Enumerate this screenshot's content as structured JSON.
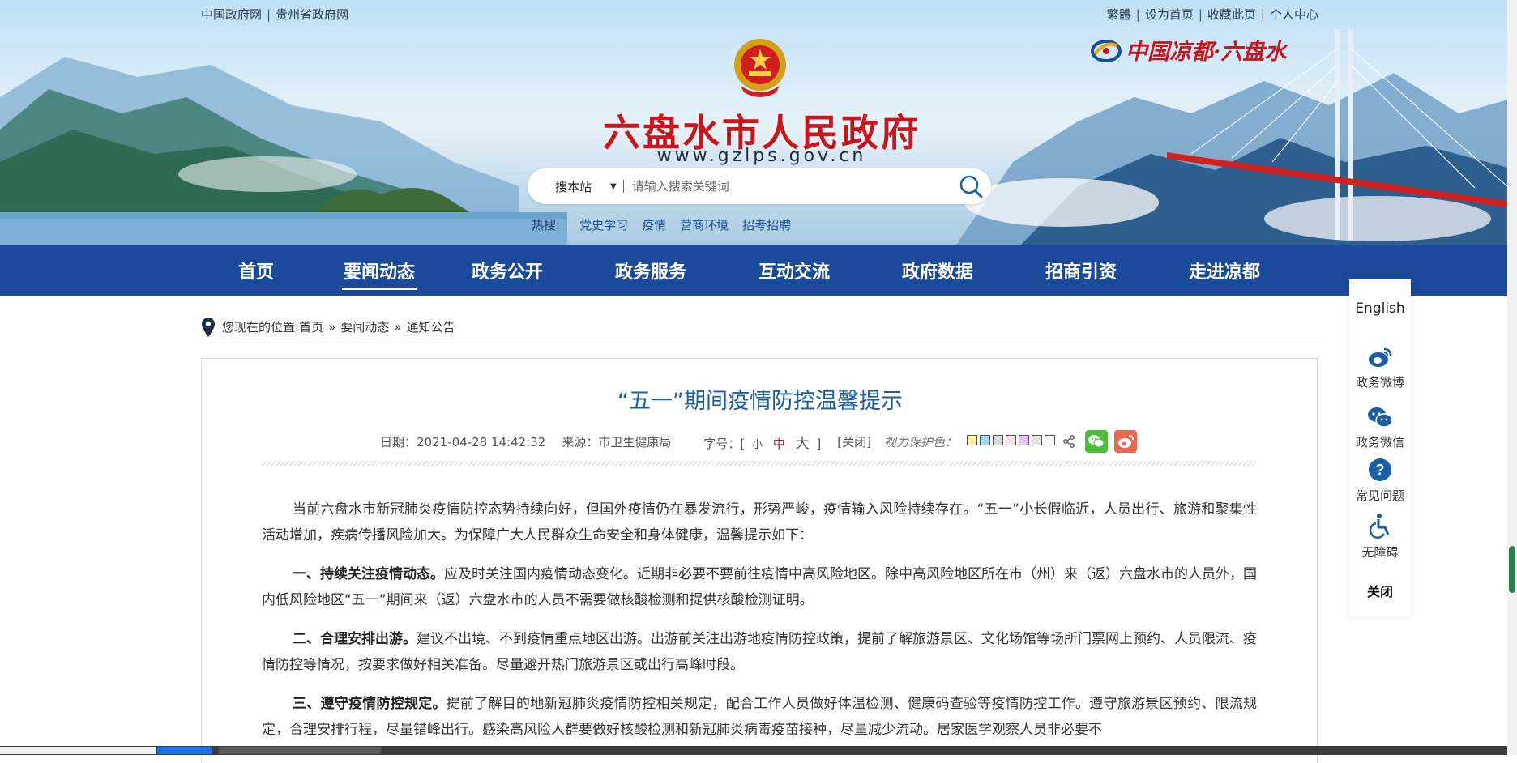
{
  "topbar": {
    "left_links": [
      "中国政府网",
      "贵州省政府网"
    ],
    "right_links": [
      "繁體",
      "设为首页",
      "收藏此页",
      "个人中心"
    ],
    "separator": "|"
  },
  "header": {
    "title": "六盘水市人民政府",
    "url": "www.gzlps.gov.cn",
    "brand_text": "中国凉都·六盘水",
    "emblem_icon": "national-emblem-icon"
  },
  "search": {
    "scope": "搜本站",
    "scope_caret": "▼",
    "placeholder": "请输入搜索关键词",
    "hot_label": "热搜:",
    "hot_words": [
      "党史学习",
      "疫情",
      "营商环境",
      "招考招聘"
    ]
  },
  "nav": {
    "items": [
      "首页",
      "要闻动态",
      "政务公开",
      "政务服务",
      "互动交流",
      "政府数据",
      "招商引资",
      "走进凉都"
    ],
    "active_index": 1
  },
  "breadcrumb": {
    "prefix": "您现在的位置:",
    "items": [
      "首页",
      "要闻动态",
      "通知公告"
    ],
    "separator": "»"
  },
  "article": {
    "title": "“五一”期间疫情防控温馨提示",
    "date": "日期：2021-04-28 14:42:32",
    "source": "来源：市卫生健康局",
    "font_label": "字号：",
    "font_open": "[",
    "font_small": "小",
    "font_medium": "中",
    "font_large": "大",
    "font_close": "]",
    "close_link": "[关闭]",
    "protect_label": "视力保护色：",
    "protect_colors": [
      "#fbf6a6",
      "#a9d6f5",
      "#dcdcdc",
      "#fbe2ea",
      "#dcc6f5",
      "#e6e6e6",
      "#ffffff"
    ],
    "paragraphs": [
      {
        "lead": "",
        "text": "当前六盘水市新冠肺炎疫情防控态势持续向好，但国外疫情仍在暴发流行，形势严峻，疫情输入风险持续存在。“五一”小长假临近，人员出行、旅游和聚集性活动增加，疾病传播风险加大。为保障广大人民群众生命安全和身体健康，温馨提示如下："
      },
      {
        "lead": "一、持续关注疫情动态。",
        "text": "应及时关注国内疫情动态变化。近期非必要不要前往疫情中高风险地区。除中高风险地区所在市（州）来（返）六盘水市的人员外，国内低风险地区“五一”期间来（返）六盘水市的人员不需要做核酸检测和提供核酸检测证明。"
      },
      {
        "lead": "二、合理安排出游。",
        "text": "建议不出境、不到疫情重点地区出游。出游前关注出游地疫情防控政策，提前了解旅游景区、文化场馆等场所门票网上预约、人员限流、疫情防控等情况，按要求做好相关准备。尽量避开热门旅游景区或出行高峰时段。"
      },
      {
        "lead": "三、遵守疫情防控规定。",
        "text": "提前了解目的地新冠肺炎疫情防控相关规定，配合工作人员做好体温检测、健康码查验等疫情防控工作。遵守旅游景区预约、限流规定，合理安排行程，尽量错峰出行。感染高风险人群要做好核酸检测和新冠肺炎病毒疫苗接种，尽量减少流动。居家医学观察人员非必要不"
      }
    ]
  },
  "float_panel": {
    "english": "English",
    "items": [
      {
        "label": "政务微博",
        "icon": "weibo-icon"
      },
      {
        "label": "政务微信",
        "icon": "wechat-icon"
      },
      {
        "label": "常见问题",
        "icon": "question-icon"
      },
      {
        "label": "无障碍",
        "icon": "accessibility-icon"
      }
    ],
    "close": "关闭"
  },
  "colors": {
    "nav_bg": "#1b4a9a",
    "title_red": "#c8161d",
    "article_title_blue": "#1b5ea8",
    "wechat_green": "#4cbf3a",
    "weibo_orange": "#e8694f"
  }
}
